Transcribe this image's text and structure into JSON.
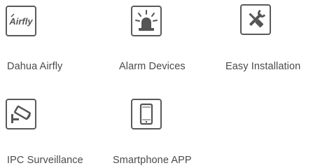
{
  "features": [
    {
      "label": "Dahua Airfly",
      "icon": "airfly-logo-icon",
      "logo_text": "Airfly"
    },
    {
      "label": "Alarm Devices",
      "icon": "alarm-siren-icon"
    },
    {
      "label": "Easy Installation",
      "icon": "tools-icon"
    },
    {
      "label": "IPC Surveillance",
      "icon": "security-camera-icon"
    },
    {
      "label": "Smartphone APP",
      "icon": "smartphone-icon"
    }
  ]
}
